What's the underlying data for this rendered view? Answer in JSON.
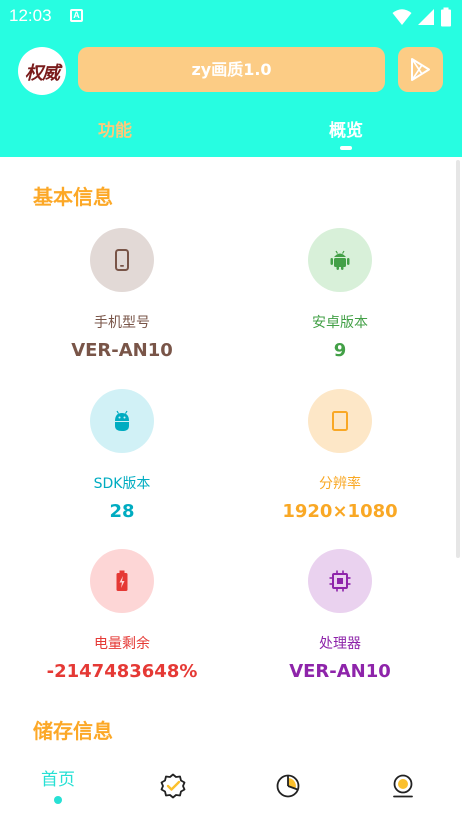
{
  "status_bar": {
    "time": "12:03",
    "notification_icon": "A"
  },
  "header": {
    "avatar_text": "权威",
    "title": "zy画质1.0",
    "tabs": [
      {
        "label": "功能"
      },
      {
        "label": "概览"
      }
    ]
  },
  "sections": {
    "basic_title": "基本信息",
    "storage_title": "储存信息"
  },
  "info_items": [
    {
      "icon": "phone-icon",
      "label": "手机型号",
      "value": "VER-AN10",
      "color": "#795548",
      "bg": "#e2d9d6"
    },
    {
      "icon": "android-icon",
      "label": "安卓版本",
      "value": "9",
      "color": "#43a047",
      "bg": "#d8f0d9"
    },
    {
      "icon": "sdk-android-icon",
      "label": "SDK版本",
      "value": "28",
      "color": "#00acc1",
      "bg": "#d1f1f6"
    },
    {
      "icon": "screen-icon",
      "label": "分辨率",
      "value": "1920×1080",
      "color": "#f9a825",
      "bg": "#fde7c7"
    },
    {
      "icon": "battery-icon",
      "label": "电量剩余",
      "value": "-2147483648%",
      "color": "#e53935",
      "bg": "#fdd6d6"
    },
    {
      "icon": "chip-icon",
      "label": "处理器",
      "value": "VER-AN10",
      "color": "#8e24aa",
      "bg": "#ead2ef"
    }
  ],
  "bottom_nav": {
    "home_label": "首页",
    "accent": "#27e0d4"
  },
  "colors": {
    "header_bg": "#27fde1",
    "pill": "#fccc85",
    "section_title": "#fca827"
  }
}
